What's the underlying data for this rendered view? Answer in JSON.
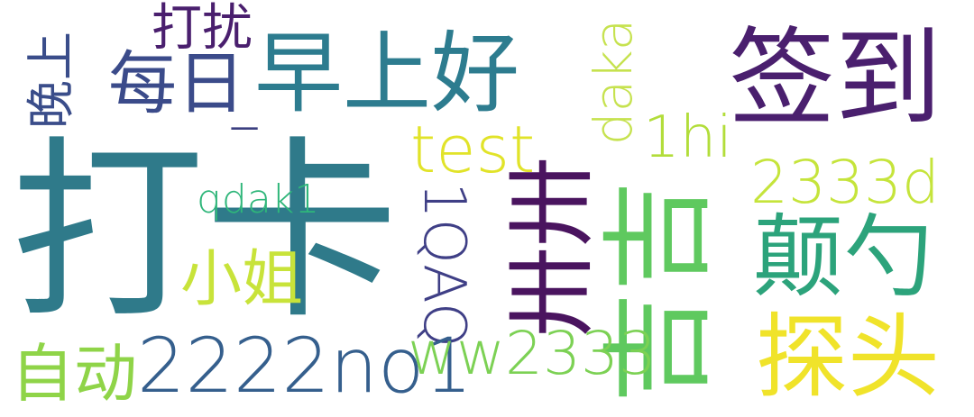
{
  "words": [
    {
      "text": "打卡",
      "color": "#2f7a8a"
    },
    {
      "text": "签到",
      "color": "#4a1f6e"
    },
    {
      "text": "早上好",
      "color": "#2d7c8f"
    },
    {
      "text": "每日",
      "color": "#3b4b8a"
    },
    {
      "text": "打扰",
      "color": "#4a1f6e"
    },
    {
      "text": "晚上",
      "color": "#3a4d8a"
    },
    {
      "text": "test",
      "color": "#e1e329"
    },
    {
      "text": "daka",
      "color": "#c6e24f"
    },
    {
      "text": "1hi",
      "color": "#b2dd3a"
    },
    {
      "text": "2333d",
      "color": "#c5e43b"
    },
    {
      "text": "qdak1",
      "color": "#2fb67a"
    },
    {
      "text": "1QAQ",
      "color": "#3f3f86"
    },
    {
      "text": "卅卅",
      "color": "#4a145f"
    },
    {
      "text": "吉吉",
      "color": "#5fc95f"
    },
    {
      "text": "颠勺",
      "color": "#2ca37b"
    },
    {
      "text": "小姐",
      "color": "#c8e33a"
    },
    {
      "text": "自动",
      "color": "#8fd448"
    },
    {
      "text": "2222no1",
      "color": "#355f8d"
    },
    {
      "text": "ww2333",
      "color": "#7cd154"
    },
    {
      "text": "探头",
      "color": "#f0e32a"
    },
    {
      "text": "一",
      "color": "#3b3f80"
    }
  ]
}
